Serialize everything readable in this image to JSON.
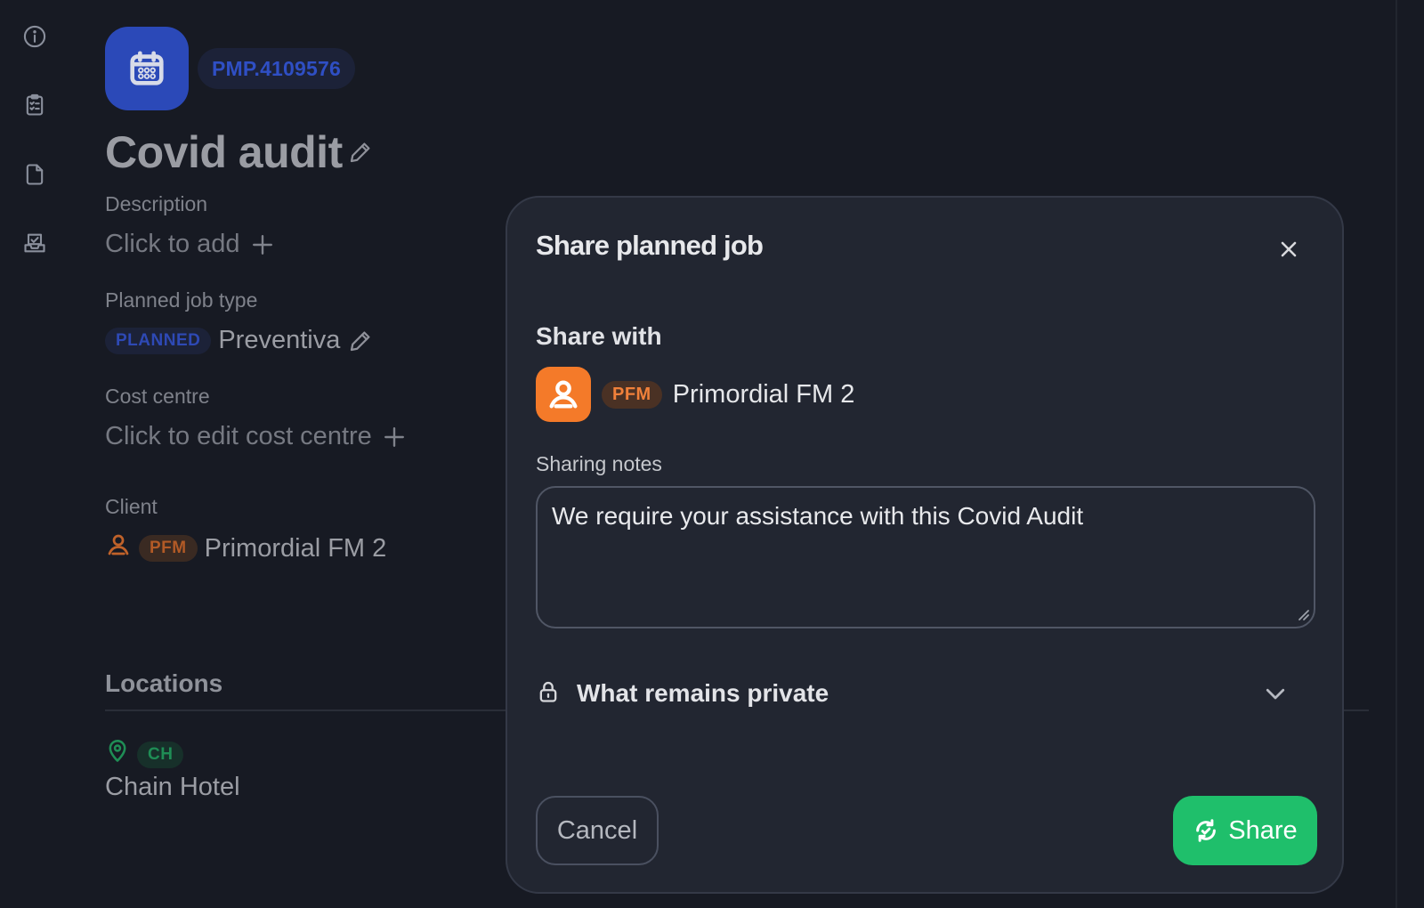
{
  "rail": {
    "icons": [
      "info-icon",
      "clipboard-checklist-icon",
      "document-icon",
      "inbox-check-icon"
    ]
  },
  "job": {
    "code": "PMP.4109576",
    "title": "Covid audit",
    "description_label": "Description",
    "description_placeholder": "Click to add",
    "type_label": "Planned job type",
    "type_badge": "PLANNED",
    "type_value": "Preventiva",
    "cost_centre_label": "Cost centre",
    "cost_centre_placeholder": "Click to edit cost centre",
    "client_label": "Client",
    "client_badge": "PFM",
    "client_name": "Primordial FM 2",
    "locations_heading": "Locations",
    "location_badge": "CH",
    "location_name": "Chain Hotel"
  },
  "modal": {
    "title": "Share planned job",
    "share_with_label": "Share with",
    "recipient_badge": "PFM",
    "recipient_name": "Primordial FM 2",
    "notes_label": "Sharing notes",
    "notes_value": "We require your assistance with this Covid Audit",
    "private_label": "What remains private",
    "cancel_label": "Cancel",
    "share_label": "Share"
  },
  "colors": {
    "accent_green": "#1fbf6b",
    "accent_orange": "#f47a29",
    "accent_blue": "#2b49b8",
    "background": "#171a23",
    "modal_background": "#222631"
  }
}
